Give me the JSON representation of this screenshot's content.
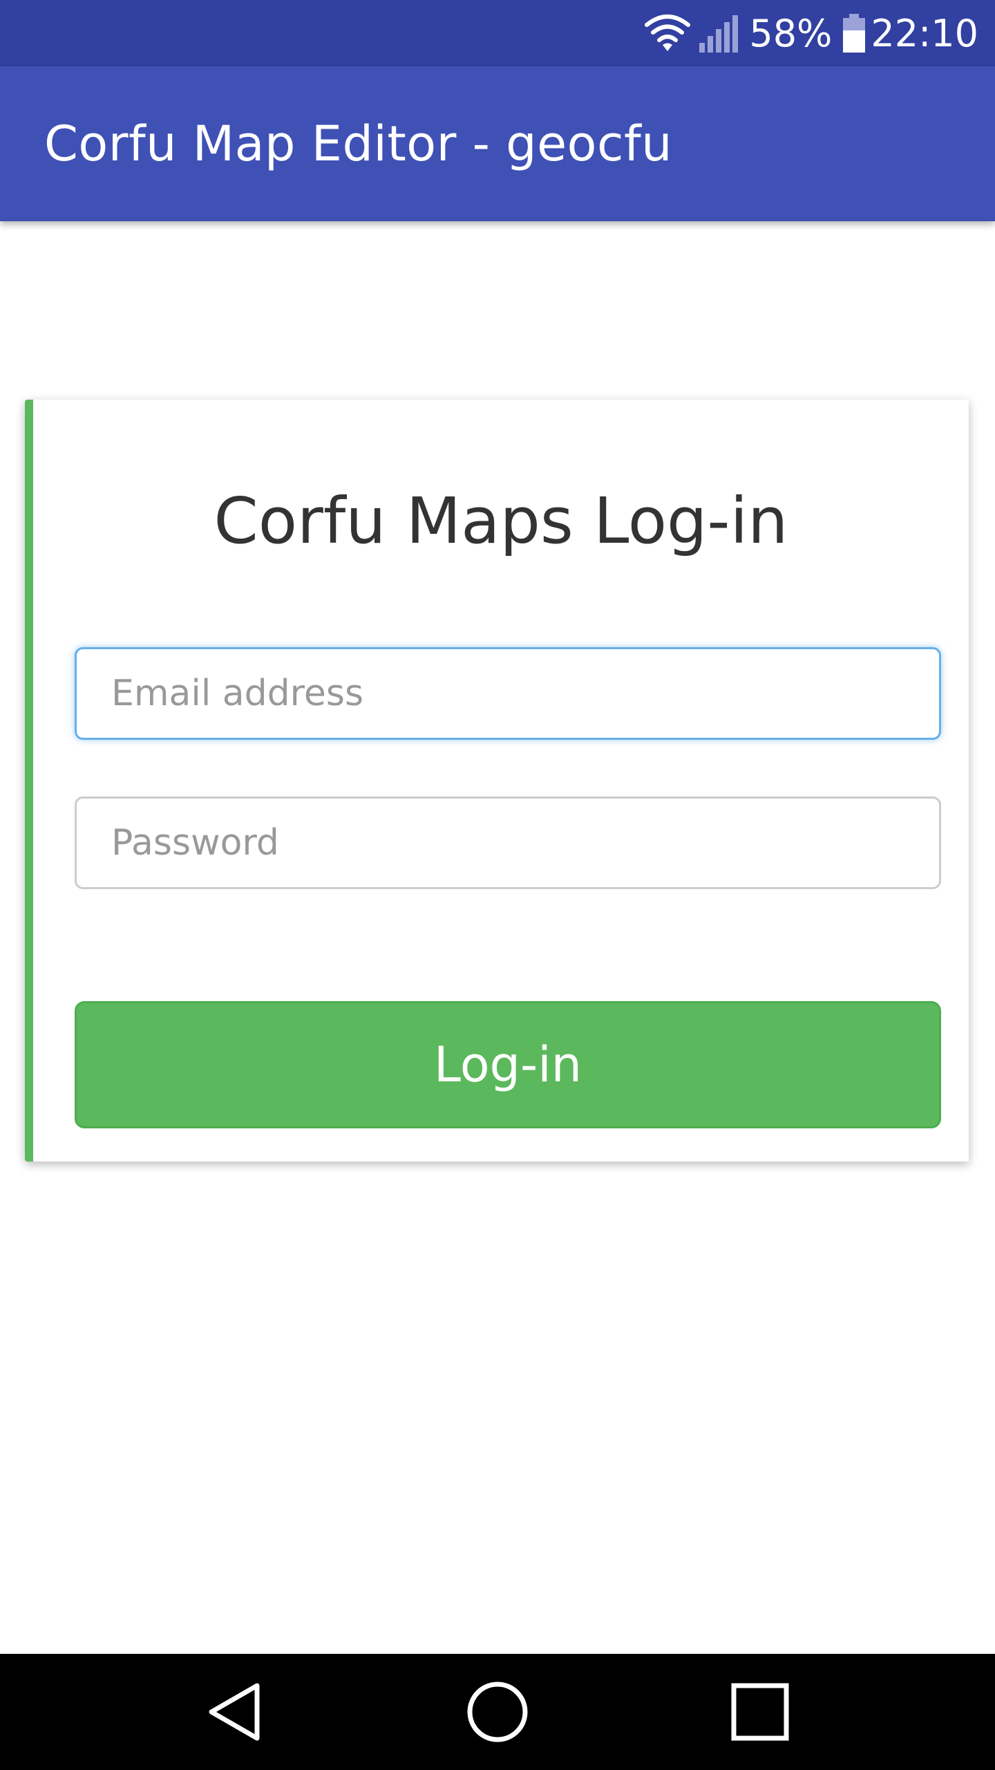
{
  "status_bar": {
    "wifi_icon": "wifi-icon",
    "signal_icon": "cell-signal-icon",
    "battery_percent": "58%",
    "battery_icon": "battery-icon",
    "time": "22:10",
    "background_color": "#3140a1"
  },
  "app_bar": {
    "title": "Corfu Map Editor - geocfu",
    "background_color": "#3f51b5"
  },
  "login_card": {
    "title": "Corfu Maps Log-in",
    "accent_color": "#5cb85c",
    "email": {
      "placeholder": "Email address",
      "value": ""
    },
    "password": {
      "placeholder": "Password",
      "value": ""
    },
    "submit_label": "Log-in"
  },
  "nav_bar": {
    "buttons": [
      "back-icon",
      "home-icon",
      "recent-apps-icon"
    ]
  }
}
